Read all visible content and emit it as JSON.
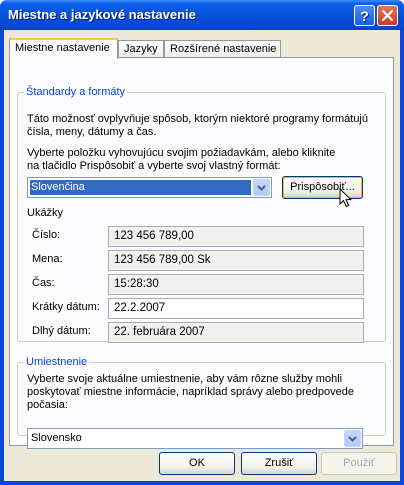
{
  "window": {
    "title": "Miestne a jazykové nastavenie"
  },
  "tabs": [
    {
      "label": "Miestne nastavenie",
      "active": true
    },
    {
      "label": "Jazyky",
      "active": false
    },
    {
      "label": "Rozšírené nastavenie",
      "active": false
    }
  ],
  "standards": {
    "legend": "Štandardy a formáty",
    "desc_line1": "Táto možnosť ovplyvňuje spôsob, ktorým niektoré programy formátujú",
    "desc_line2": "čísla, meny, dátumy a čas.",
    "select_line1": "Vyberte položku vyhovujúcu svojim požiadavkám, alebo kliknite",
    "select_line2": "na tlačidlo Prispôsobiť a vyberte svoj vlastný formát:",
    "format_value": "Slovenčina",
    "customize_label": "Prispôsobiť..."
  },
  "samples": {
    "heading": "Ukážky",
    "rows": [
      {
        "label": "Číslo:",
        "value": "123 456 789,00"
      },
      {
        "label": "Mena:",
        "value": "123 456 789,00 Sk"
      },
      {
        "label": "Čas:",
        "value": "15:28:30"
      },
      {
        "label": "Krátky dátum:",
        "value": "22.2.2007"
      },
      {
        "label": "Dlhý dátum:",
        "value": "22. februára 2007"
      }
    ]
  },
  "location": {
    "legend": "Umiestnenie",
    "desc_line1": "Vyberte svoje aktuálne umiestnenie, aby vám rôzne služby mohli",
    "desc_line2": "poskytovať miestne informácie, napríklad správy alebo predpovede",
    "desc_line3": "počasia:",
    "value": "Slovensko"
  },
  "buttons": {
    "ok": "OK",
    "cancel": "Zrušiť",
    "apply": "Použiť"
  },
  "colors": {
    "titlebar": "#0750d6",
    "accent": "#0046d5",
    "selection": "#316ac5"
  }
}
